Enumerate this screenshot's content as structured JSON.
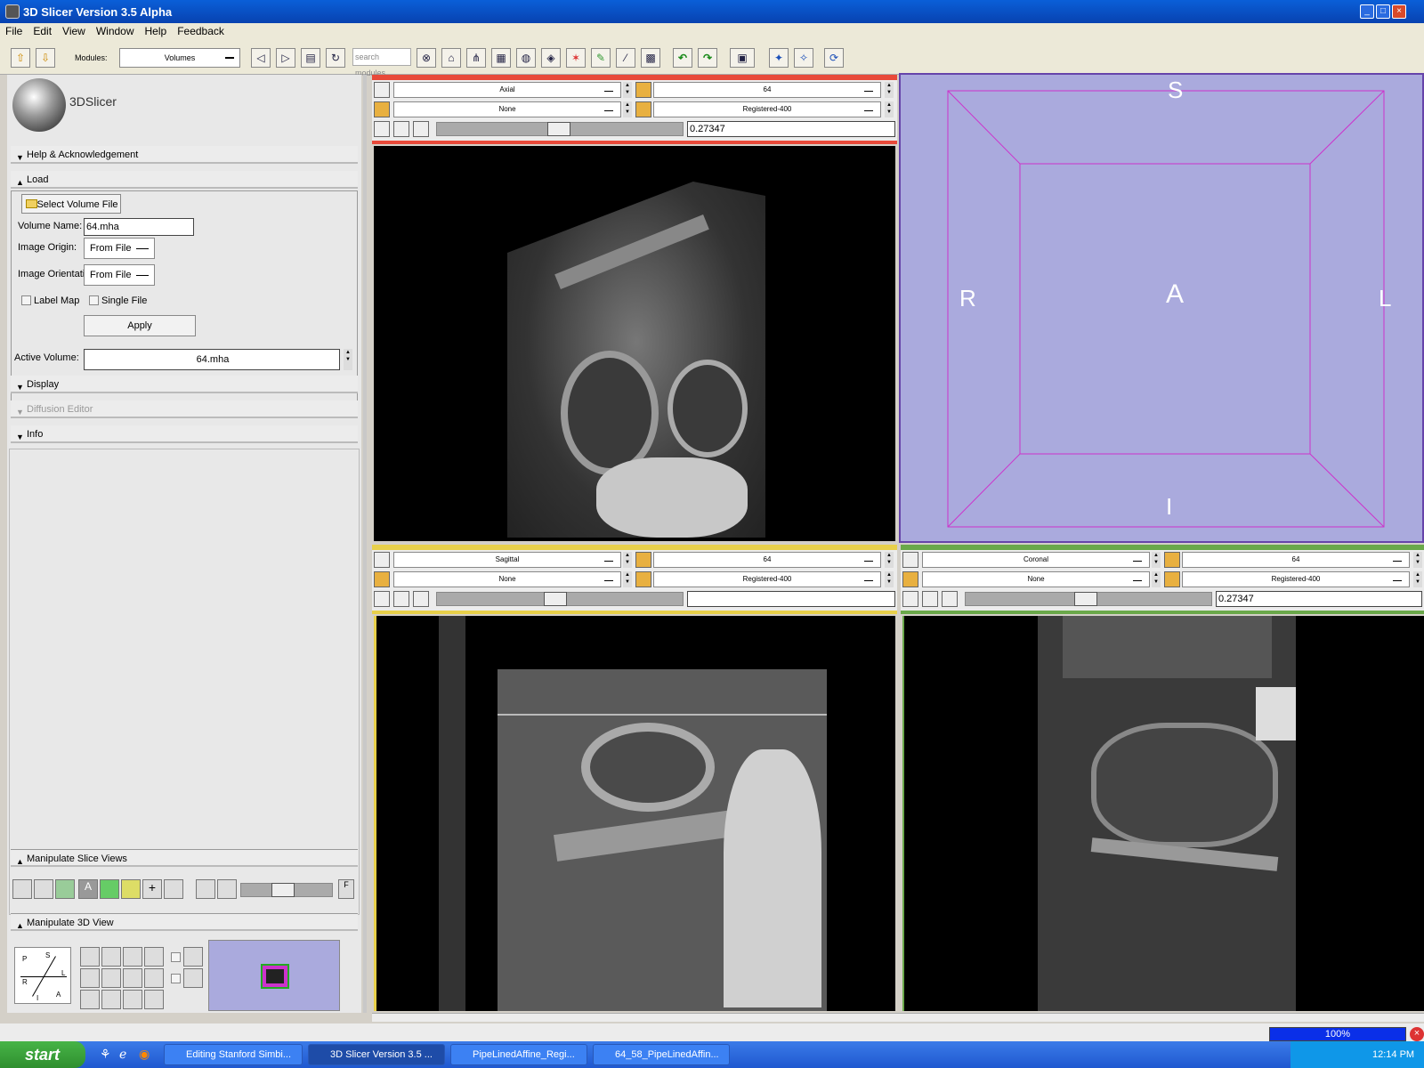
{
  "window": {
    "title": "3D Slicer Version 3.5 Alpha"
  },
  "menu": [
    "File",
    "Edit",
    "View",
    "Window",
    "Help",
    "Feedback"
  ],
  "toolbar": {
    "modules_label": "Modules:",
    "module_value": "Volumes",
    "search_placeholder": "search modules"
  },
  "logo": {
    "text": "3DSlicer"
  },
  "sections": {
    "help": "Help & Acknowledgement",
    "load": "Load",
    "display": "Display",
    "diffusion": "Diffusion Editor",
    "info": "Info",
    "manip_slice": "Manipulate Slice Views",
    "manip_3d": "Manipulate 3D View"
  },
  "load": {
    "select_file": "Select Volume File",
    "volume_name_label": "Volume Name:",
    "volume_name_value": "64.mha",
    "origin_label": "Image Origin:",
    "origin_value": "From File",
    "orientation_label": "Image Orientatic",
    "orientation_value": "From File",
    "labelmap": "Label Map",
    "singlefile": "Single File",
    "apply": "Apply"
  },
  "active_volume": {
    "label": "Active Volume:",
    "value": "64.mha"
  },
  "views": {
    "red": {
      "orientation": "Axial",
      "fg": "64",
      "label": "None",
      "bg": "Registered-400",
      "offset": "0.27347"
    },
    "yellow": {
      "orientation": "Sagittal",
      "fg": "64",
      "label": "None",
      "bg": "Registered-400",
      "offset": ""
    },
    "green": {
      "orientation": "Coronal",
      "fg": "64",
      "label": "None",
      "bg": "Registered-400",
      "offset": "0.27347"
    }
  },
  "view3d": {
    "s": "S",
    "i": "I",
    "r": "R",
    "l": "L",
    "a": "A",
    "bg_color": "#aaaadd",
    "box_color": "#cc33cc"
  },
  "orient_cube": {
    "p": "P",
    "s": "S",
    "r": "R",
    "l": "L",
    "i": "I",
    "a": "A"
  },
  "status": {
    "progress": "100%"
  },
  "taskbar": {
    "start": "start",
    "tasks": [
      "Editing Stanford Simbi...",
      "3D Slicer Version 3.5 ...",
      "PipeLinedAffine_Regi...",
      "64_58_PipeLinedAffin..."
    ],
    "clock": "12:14 PM"
  },
  "colors": {
    "red": "#e84a3a",
    "yellow": "#e8d04a",
    "green": "#6aa84a"
  }
}
